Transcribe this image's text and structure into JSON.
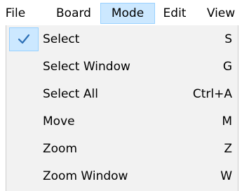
{
  "menubar": {
    "items": [
      {
        "label": "File"
      },
      {
        "label": "Board"
      },
      {
        "label": "Mode",
        "active": true
      },
      {
        "label": "Edit"
      },
      {
        "label": "View"
      }
    ]
  },
  "mode_menu": {
    "check_icon": "checkmark-icon",
    "items": [
      {
        "label": "Select",
        "shortcut": "S",
        "checked": true
      },
      {
        "label": "Select Window",
        "shortcut": "G"
      },
      {
        "label": "Select All",
        "shortcut": "Ctrl+A"
      },
      {
        "label": "Move",
        "shortcut": "M"
      },
      {
        "label": "Zoom",
        "shortcut": "Z"
      },
      {
        "label": "Zoom Window",
        "shortcut": "W"
      }
    ]
  },
  "colors": {
    "highlight_fill": "#cce8ff",
    "highlight_border": "#99d1ff",
    "menu_background": "#f2f2f2",
    "check_color": "#2b6fb6"
  }
}
